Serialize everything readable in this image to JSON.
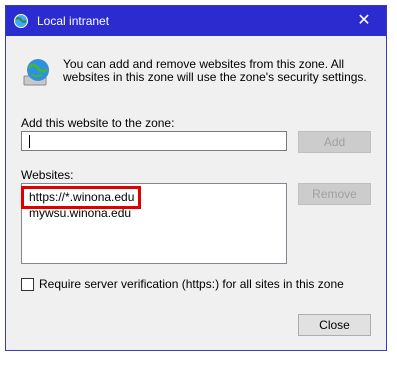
{
  "window": {
    "title": "Local intranet",
    "close_glyph": "✕",
    "title_icon": "globe-shield-icon",
    "accent": "#2b2bd0"
  },
  "info": {
    "icon": "globe-info-icon",
    "text": "You can add and remove websites from this zone. All websites in this zone will use the zone's security settings."
  },
  "add_section": {
    "label": "Add this website to the zone:",
    "value": "",
    "add_button": "Add"
  },
  "websites_section": {
    "label": "Websites:",
    "items": [
      "https://*.winona.edu",
      "mywsu.winona.edu"
    ],
    "remove_button": "Remove",
    "highlight_color": "#e00000"
  },
  "verification": {
    "label": "Require server verification (https:) for all sites in this zone",
    "checked": false
  },
  "footer": {
    "close_button": "Close"
  }
}
